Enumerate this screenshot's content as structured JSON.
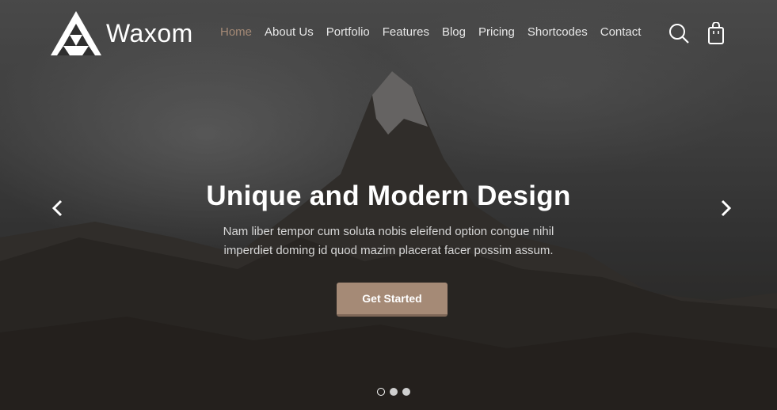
{
  "brand": {
    "name": "Waxom",
    "logo_icon": "triangle-logo-icon"
  },
  "nav": {
    "items": [
      {
        "label": "Home",
        "active": true
      },
      {
        "label": "About Us"
      },
      {
        "label": "Portfolio"
      },
      {
        "label": "Features"
      },
      {
        "label": "Blog"
      },
      {
        "label": "Pricing"
      },
      {
        "label": "Shortcodes"
      },
      {
        "label": "Contact"
      }
    ],
    "icons": [
      "search-icon",
      "shopping-bag-icon"
    ]
  },
  "slider": {
    "title": "Unique and Modern Design",
    "subtitle_line1": "Nam liber tempor cum soluta nobis eleifend option congue nihil",
    "subtitle_line2": "imperdiet doming id quod mazim placerat facer possim assum.",
    "cta_label": "Get Started",
    "prev_icon": "chevron-left-icon",
    "next_icon": "chevron-right-icon",
    "slide_count": 3,
    "active_slide": 1
  },
  "colors": {
    "accent": "#a58a76",
    "accent_dark": "#7f6858",
    "text": "#ffffff"
  }
}
